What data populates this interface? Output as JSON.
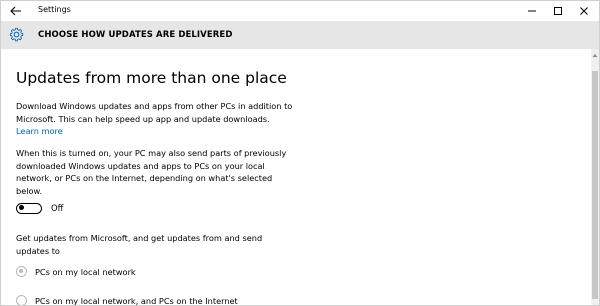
{
  "window": {
    "app_title": "Settings",
    "back_icon": "back-arrow-icon",
    "controls": [
      "minimize-icon",
      "maximize-icon",
      "close-icon"
    ]
  },
  "header": {
    "icon": "gear-icon",
    "title": "CHOOSE HOW UPDATES ARE DELIVERED"
  },
  "main": {
    "section_title": "Updates from more than one place",
    "intro_text": "Download Windows updates and apps from other PCs in addition to Microsoft. This can help speed up app and update downloads.",
    "learn_more_label": "Learn more",
    "share_text": "When this is turned on, your PC may also send parts of previously downloaded Windows updates and apps to PCs on your local network, or PCs on the Internet, depending on what's selected below.",
    "toggle": {
      "state_label": "Off",
      "is_on": false
    },
    "source_prompt": "Get updates from Microsoft, and get updates from and send updates to",
    "options": [
      {
        "label": "PCs on my local network",
        "selected": true,
        "enabled": false
      },
      {
        "label": "PCs on my local network, and PCs on the Internet",
        "selected": false,
        "enabled": false
      }
    ]
  },
  "colors": {
    "header_bg": "#e6e6e6",
    "accent_link": "#0063b1",
    "gear_icon": "#0063b1",
    "disabled_radio": "#b9b9b9"
  }
}
